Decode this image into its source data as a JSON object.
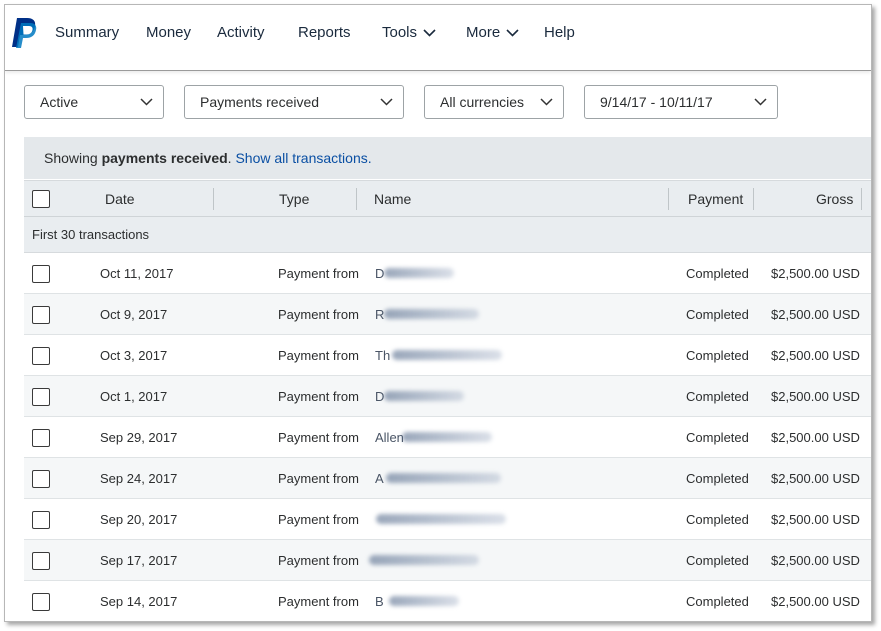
{
  "nav": {
    "items": [
      {
        "label": "Summary",
        "has_menu": false
      },
      {
        "label": "Money",
        "has_menu": false
      },
      {
        "label": "Activity",
        "has_menu": false
      },
      {
        "label": "Reports",
        "has_menu": false
      },
      {
        "label": "Tools",
        "has_menu": true
      },
      {
        "label": "More",
        "has_menu": true
      },
      {
        "label": "Help",
        "has_menu": false
      }
    ],
    "logo_icon": "paypal-logo-icon"
  },
  "filters": {
    "status": "Active",
    "type": "Payments received",
    "currency": "All currencies",
    "date_range": "9/14/17 - 10/11/17"
  },
  "banner": {
    "prefix": "Showing ",
    "bold": "payments received",
    "suffix": ". ",
    "link": "Show all transactions."
  },
  "table": {
    "columns": {
      "date": "Date",
      "type": "Type",
      "name": "Name",
      "payment": "Payment",
      "gross": "Gross"
    },
    "group_label": "First 30 transactions",
    "rows": [
      {
        "date": "Oct 11, 2017",
        "type": "Payment from",
        "name_visible": "D",
        "status": "Completed",
        "gross": "$2,500.00 USD"
      },
      {
        "date": "Oct 9, 2017",
        "type": "Payment from",
        "name_visible": "R",
        "status": "Completed",
        "gross": "$2,500.00 USD"
      },
      {
        "date": "Oct 3, 2017",
        "type": "Payment from",
        "name_visible": "Th",
        "status": "Completed",
        "gross": "$2,500.00 USD"
      },
      {
        "date": "Oct 1, 2017",
        "type": "Payment from",
        "name_visible": "D",
        "status": "Completed",
        "gross": "$2,500.00 USD"
      },
      {
        "date": "Sep 29, 2017",
        "type": "Payment from",
        "name_visible": "Allen",
        "status": "Completed",
        "gross": "$2,500.00 USD"
      },
      {
        "date": "Sep 24, 2017",
        "type": "Payment from",
        "name_visible": "A",
        "status": "Completed",
        "gross": "$2,500.00 USD"
      },
      {
        "date": "Sep 20, 2017",
        "type": "Payment from",
        "name_visible": "",
        "status": "Completed",
        "gross": "$2,500.00 USD"
      },
      {
        "date": "Sep 17, 2017",
        "type": "Payment from",
        "name_visible": "",
        "status": "Completed",
        "gross": "$2,500.00 USD"
      },
      {
        "date": "Sep 14, 2017",
        "type": "Payment from",
        "name_visible": "B",
        "status": "Completed",
        "gross": "$2,500.00 USD"
      }
    ]
  },
  "colors": {
    "link": "#0a4fa3",
    "header_bg": "#e9edf0",
    "paypal_dark": "#003087",
    "paypal_light": "#009cde"
  }
}
